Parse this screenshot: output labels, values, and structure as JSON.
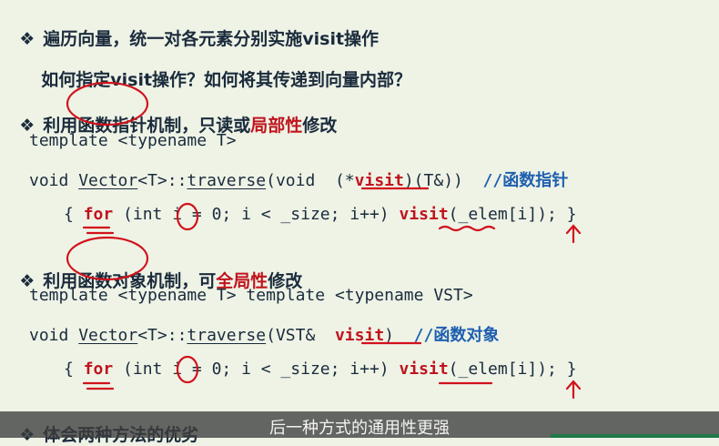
{
  "bullets": [
    {
      "text": "遍历向量，统一对各元素分别实施visit操作"
    },
    {
      "text": "利用",
      "highlight": "函数指针",
      "mid": "机制，只读或",
      "red": "局部性",
      "tail": "修改"
    },
    {
      "text": "利用",
      "highlight": "函数对象",
      "mid": "机制，可",
      "red": "全局性",
      "tail": "修改"
    },
    {
      "text": "体会两种方法的优劣"
    }
  ],
  "question": "如何指定visit操作？如何将其传递到向量内部？",
  "code1": {
    "line1": "template <typename T>",
    "line2_a": "void ",
    "line2_vector": "Vector",
    "line2_b": "<T>::",
    "line2_traverse": "traverse",
    "line2_c": "(void  (*",
    "line2_visit": "visit",
    "line2_d": ")(T&))  ",
    "line2_comment": "//函数指针",
    "line3_a": "{ ",
    "line3_for": "for",
    "line3_b": " (int i = 0; i < _size; i++) ",
    "line3_visit": "visit",
    "line3_c": "(_elem[i]); }"
  },
  "code2": {
    "line1": "template <typename T> template <typename VST>",
    "line2_a": "void ",
    "line2_vector": "Vector",
    "line2_b": "<T>::",
    "line2_traverse": "traverse",
    "line2_c": "(VST&  ",
    "line2_visit": "visit",
    "line2_d": ")  ",
    "line2_comment": "//函数对象",
    "line3_a": "{ ",
    "line3_for": "for",
    "line3_b": " (int i = 0; i < _size; i++) ",
    "line3_visit": "visit",
    "line3_c": "(_elem[i]); }"
  },
  "bullet_glyph": "❖",
  "subtitle": "后一种方式的通用性更强"
}
